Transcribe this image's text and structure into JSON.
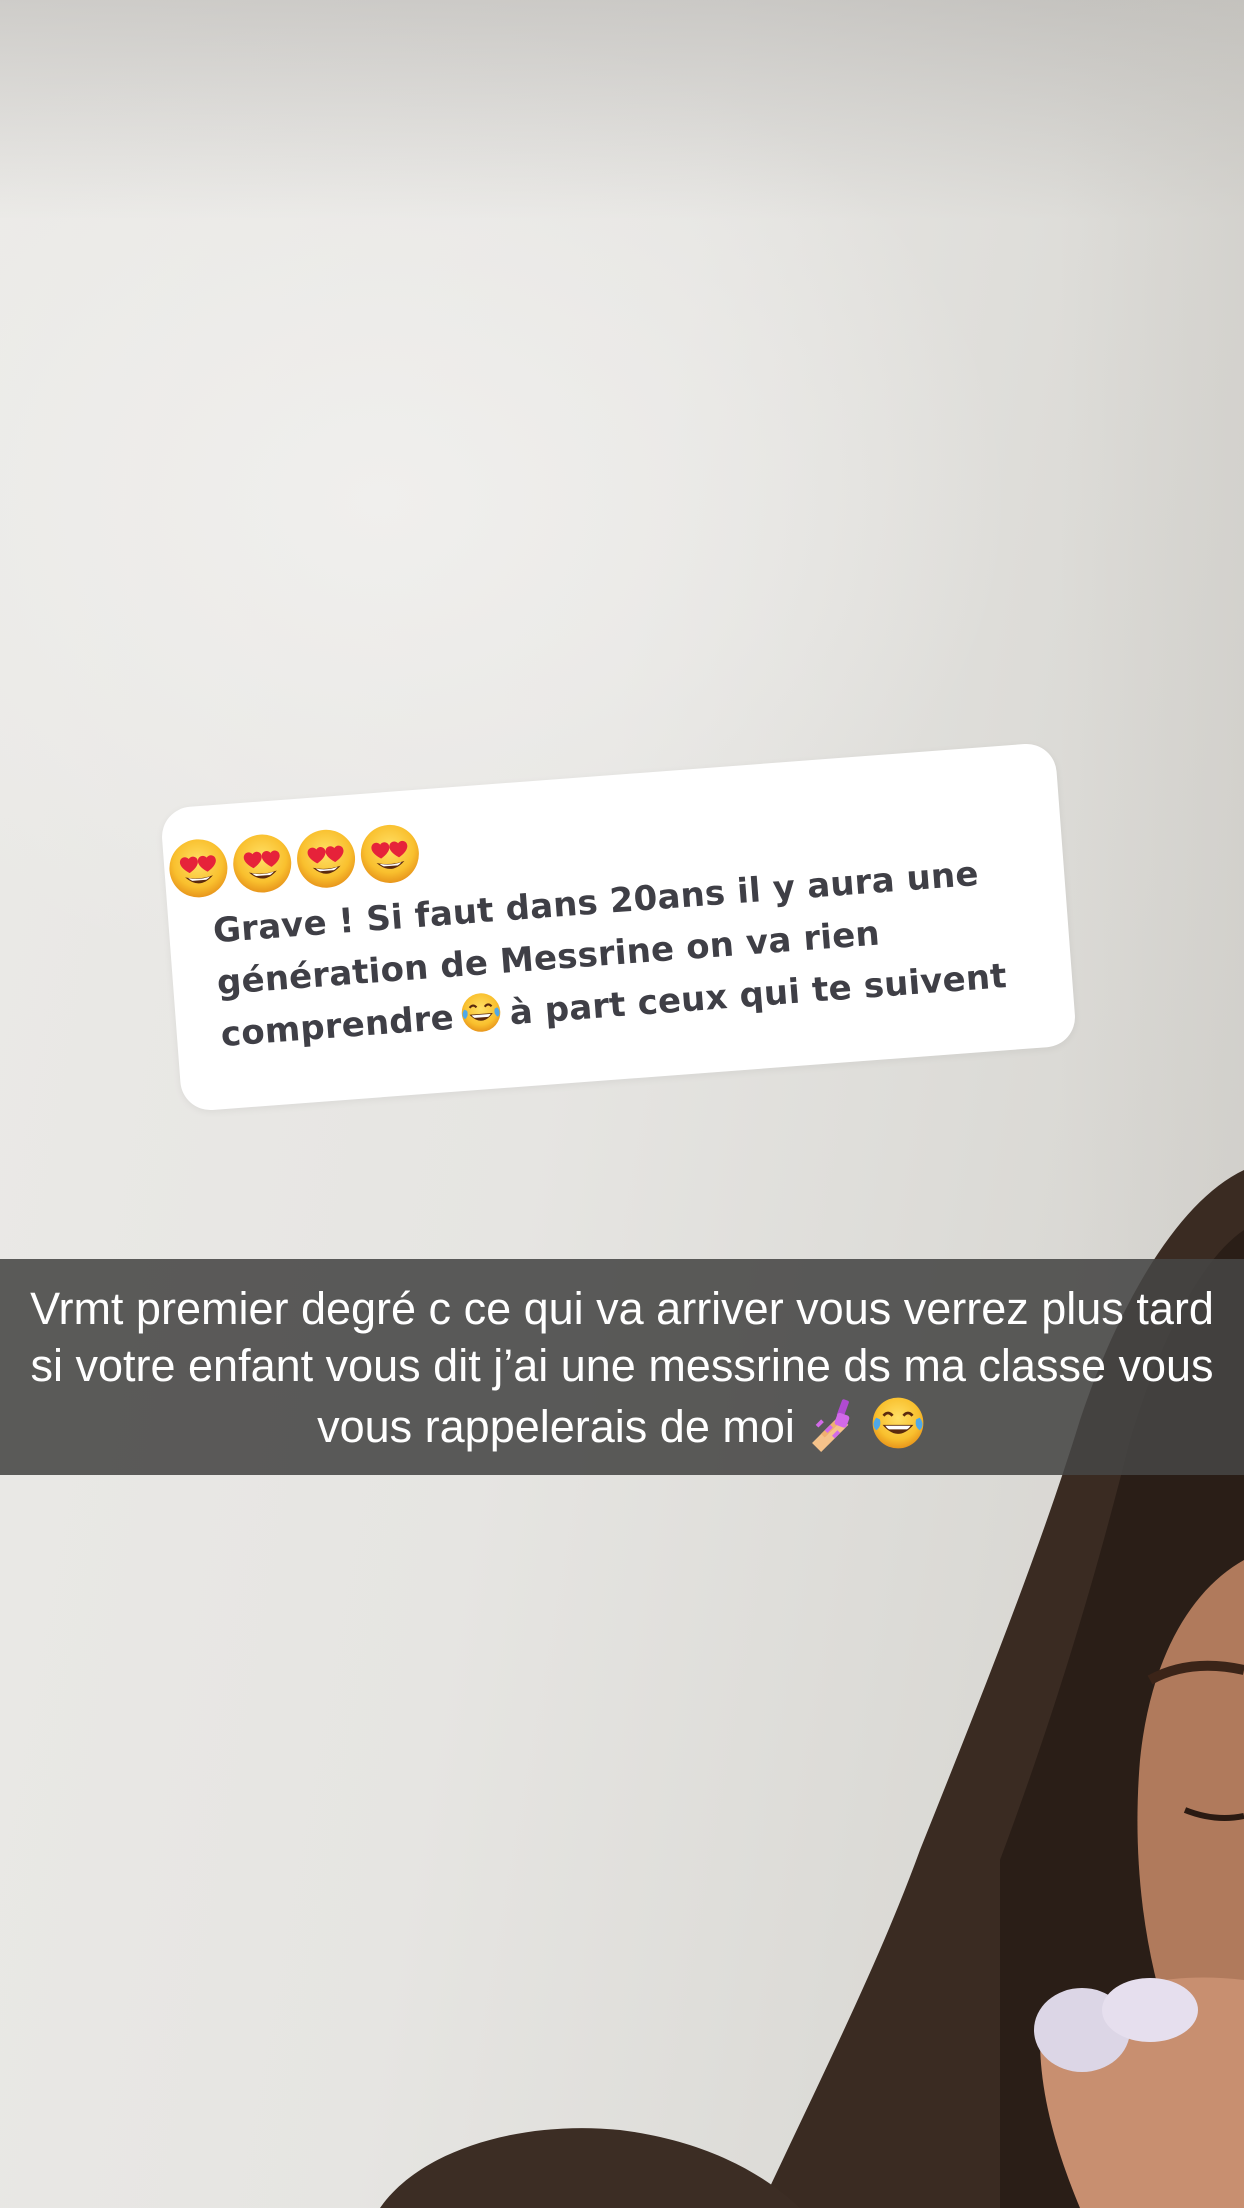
{
  "question_sticker": {
    "emojis": [
      "heart-eyes-emoji",
      "heart-eyes-emoji",
      "heart-eyes-emoji",
      "heart-eyes-emoji"
    ],
    "text_part1": "Grave ! Si faut dans 20ans il y aura une génération de Messrine on va rien comprendre",
    "inline_emoji": "tears-of-joy-emoji",
    "text_part2": "à part ceux qui te suivent"
  },
  "caption": {
    "text": "Vrmt premier degré c ce qui va arriver vous verrez plus tard si votre enfant vous dit j’ai une messrine ds ma classe vous vous rappelerais de moi",
    "emojis": [
      "nail-polish-emoji",
      "tears-of-joy-emoji"
    ]
  },
  "colors": {
    "sticker_text": "#3f3f46",
    "caption_bar": "#464644",
    "caption_text": "#ffffff",
    "background": "#e6e5e2"
  }
}
